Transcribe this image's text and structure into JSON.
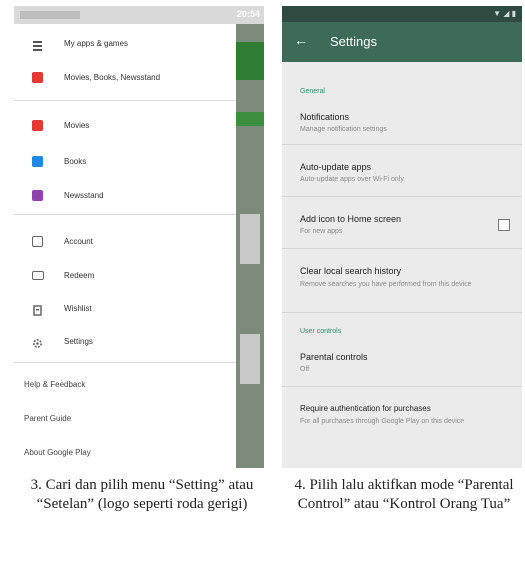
{
  "left_screen": {
    "status_time": "20:54",
    "drawer": {
      "top_items": [
        {
          "label": "My apps & games",
          "icon": "menu-icon",
          "color": "#555555"
        },
        {
          "label": "Movies, Books, Newsstand",
          "icon": "play-icon",
          "color": "#e53935"
        }
      ],
      "media_items": [
        {
          "label": "Movies",
          "icon": "movies-icon",
          "color": "#e53935"
        },
        {
          "label": "Books",
          "icon": "books-icon",
          "color": "#1e88e5"
        },
        {
          "label": "Newsstand",
          "icon": "newsstand-icon",
          "color": "#8e44ad"
        }
      ],
      "account_items": [
        {
          "label": "Account",
          "icon": "account-icon",
          "color": "#666666"
        },
        {
          "label": "Redeem",
          "icon": "redeem-icon",
          "color": "#666666"
        },
        {
          "label": "Wishlist",
          "icon": "wishlist-icon",
          "color": "#666666"
        },
        {
          "label": "Settings",
          "icon": "gear-icon",
          "color": "#666666"
        }
      ],
      "other_links": [
        "Help & Feedback",
        "Parent Guide",
        "About Google Play"
      ]
    }
  },
  "right_screen": {
    "toolbar_title": "Settings",
    "sections": {
      "general": "General",
      "user_controls": "User controls"
    },
    "items": {
      "notifications": {
        "title": "Notifications",
        "subtitle": "Manage notification settings"
      },
      "auto_update": {
        "title": "Auto-update apps",
        "subtitle": "Auto-update apps over Wi-Fi only"
      },
      "add_icon": {
        "title": "Add icon to Home screen",
        "subtitle": "For new apps"
      },
      "clear_history": {
        "title": "Clear local search history",
        "subtitle": "Remove searches you have performed from this device"
      },
      "parental": {
        "title": "Parental controls",
        "subtitle": "Off"
      },
      "auth": {
        "title": "Require authentication for purchases",
        "subtitle": "For all purchases through Google Play on this device"
      }
    }
  },
  "captions": {
    "left": "3. Cari dan pilih menu “Setting” atau “Setelan” (logo seperti roda gerigi)",
    "right": "4. Pilih lalu aktifkan mode “Parental Control” atau “Kontrol Orang Tua”"
  },
  "colors": {
    "accent": "#2e8b6b",
    "toolbar": "#3d6b57",
    "play_green": "#2e7d32"
  }
}
